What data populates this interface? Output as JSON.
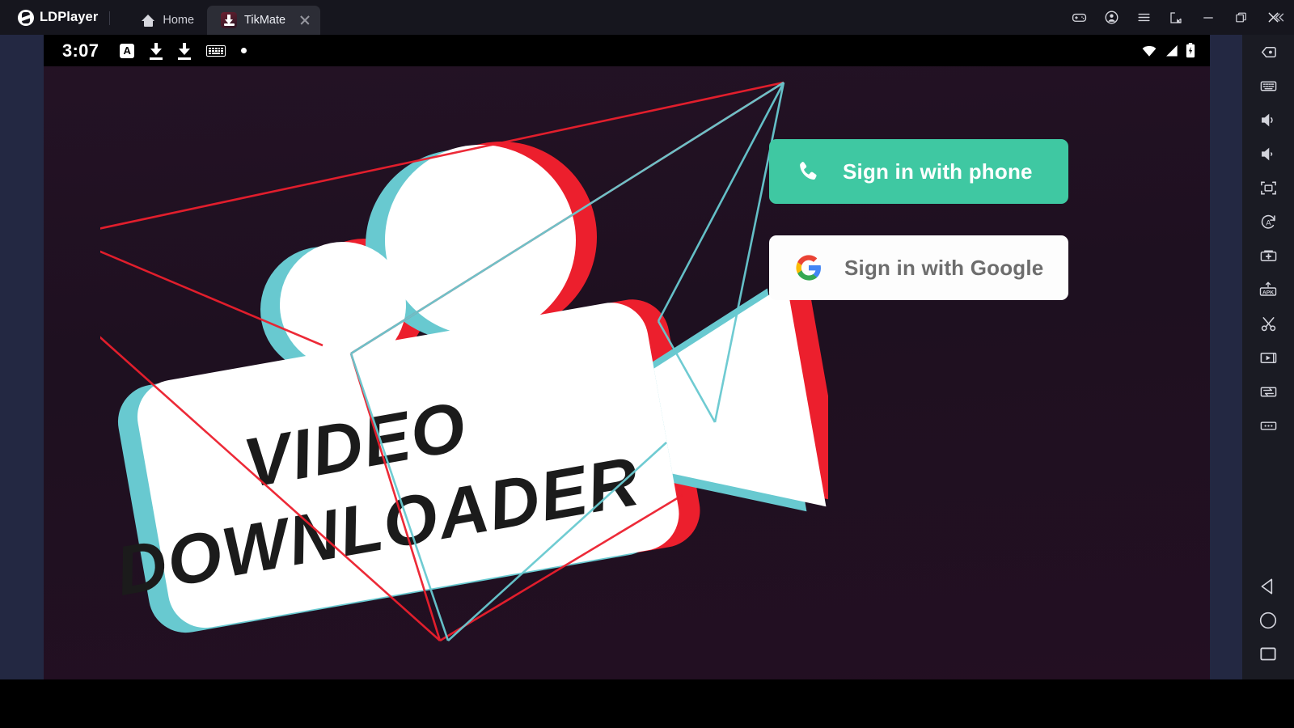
{
  "window": {
    "brand": "LDPlayer",
    "brand_logo_icon": "ldplayer-logo-icon",
    "tabs": [
      {
        "label": "Home",
        "icon": "home-icon",
        "active": false,
        "closable": false
      },
      {
        "label": "TikMate",
        "icon": "tikmate-app-icon",
        "active": true,
        "closable": true
      }
    ],
    "controls": [
      {
        "name": "gamepad-icon",
        "title": "Game controls"
      },
      {
        "name": "account-icon",
        "title": "Account"
      },
      {
        "name": "menu-icon",
        "title": "Menu"
      },
      {
        "name": "open-external-icon",
        "title": "Open"
      },
      {
        "name": "minimize-icon",
        "title": "Minimize"
      },
      {
        "name": "maximize-icon",
        "title": "Maximize"
      },
      {
        "name": "close-icon",
        "title": "Close"
      }
    ],
    "collapse_icon": "chevron-double-left-icon",
    "titlebar_color": "#16161e",
    "tab_active_color": "#2c2d36"
  },
  "android_status_bar": {
    "clock": "3:07",
    "left_icons": [
      "app-badge-a-icon",
      "download-icon",
      "download-icon",
      "keyboard-icon",
      "dot-icon"
    ],
    "badge_letter": "A",
    "right_icons": [
      "wifi-icon",
      "signal-icon",
      "battery-charging-icon"
    ],
    "background": "#000000"
  },
  "app": {
    "name": "TikMate",
    "background_color": "#1e1020",
    "logo": {
      "title_line1": "VIDEO",
      "title_line2": "DOWNLOADER",
      "description": "movie-camera-logo-with-chromatic-aberration",
      "accent_red": "#ec1f2d",
      "accent_cyan": "#68c9d0",
      "body_color": "#ffffff",
      "text_color": "#1b1b1b"
    },
    "auth": {
      "phone_button": {
        "label": "Sign in with phone",
        "icon": "phone-icon",
        "background": "#3fc8a2",
        "text_color": "#ffffff"
      },
      "google_button": {
        "label": "Sign in with Google",
        "icon": "google-g-icon",
        "background": "#ffffff",
        "text_color": "#6d6d6d"
      }
    }
  },
  "sidebar": {
    "background": "#1a1b23",
    "items": [
      {
        "name": "record-macro-icon",
        "title": "Macro recorder"
      },
      {
        "name": "keyboard-mapping-icon",
        "title": "Keyboard mapping"
      },
      {
        "name": "volume-up-icon",
        "title": "Volume up"
      },
      {
        "name": "volume-down-icon",
        "title": "Volume down"
      },
      {
        "name": "fullscreen-icon",
        "title": "Full screen"
      },
      {
        "name": "auto-rotate-icon",
        "title": "Rotate screen"
      },
      {
        "name": "add-instance-icon",
        "title": "Multi-instance"
      },
      {
        "name": "install-apk-icon",
        "title": "Install APK"
      },
      {
        "name": "screenshot-cut-icon",
        "title": "Screenshot"
      },
      {
        "name": "video-record-icon",
        "title": "Record screen"
      },
      {
        "name": "shared-folder-icon",
        "title": "Shared folder"
      },
      {
        "name": "more-options-icon",
        "title": "More"
      }
    ],
    "nav_items": [
      {
        "name": "back-icon",
        "title": "Back"
      },
      {
        "name": "home-nav-icon",
        "title": "Home"
      },
      {
        "name": "recents-icon",
        "title": "Recent apps"
      }
    ]
  }
}
